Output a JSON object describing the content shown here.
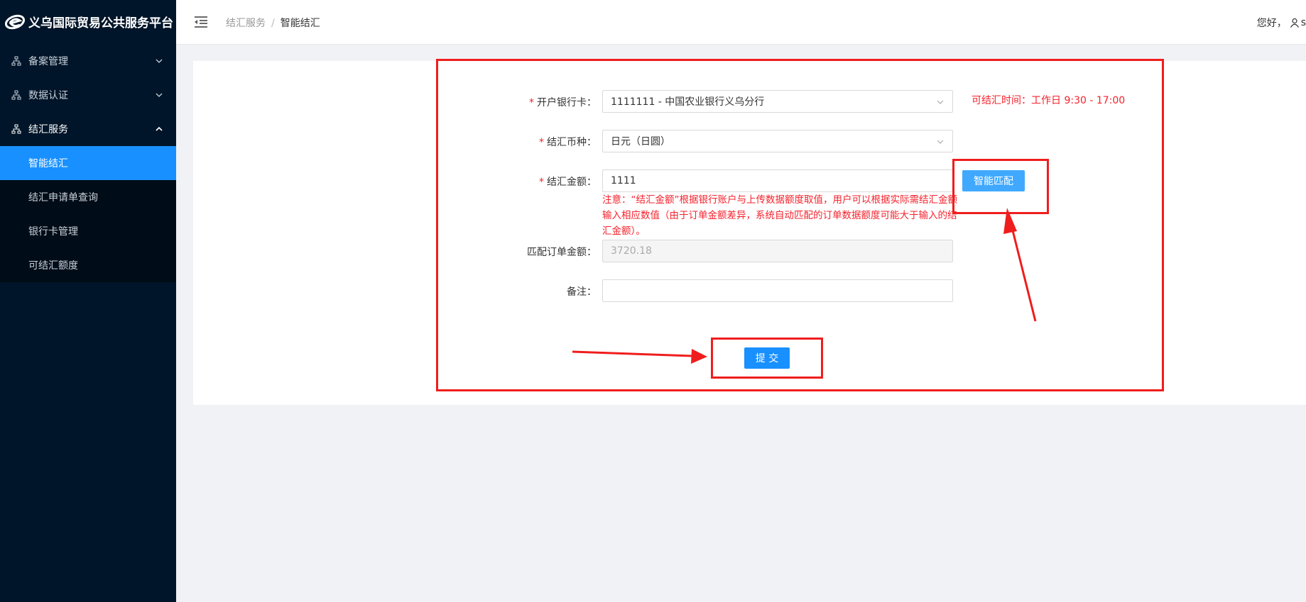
{
  "app": {
    "title": "义乌国际贸易公共服务平台"
  },
  "sidebar": {
    "menus": [
      {
        "label": "备案管理",
        "icon": "sitemap-icon",
        "open": false
      },
      {
        "label": "数据认证",
        "icon": "sitemap-icon",
        "open": false
      },
      {
        "label": "结汇服务",
        "icon": "sitemap-icon",
        "open": true
      }
    ],
    "submenu": [
      {
        "label": "智能结汇",
        "active": true
      },
      {
        "label": "结汇申请单查询",
        "active": false
      },
      {
        "label": "银行卡管理",
        "active": false
      },
      {
        "label": "可结汇额度",
        "active": false
      }
    ]
  },
  "header": {
    "breadcrumb": [
      "结汇服务",
      "智能结汇"
    ],
    "breadcrumb_sep": "/",
    "greeting": "您好，",
    "username": "s"
  },
  "form": {
    "bank_card": {
      "label": "开户银行卡：",
      "value": "1111111 - 中国农业银行义乌分行",
      "required": true
    },
    "currency": {
      "label": "结汇币种：",
      "value": "日元（日圆）",
      "required": true
    },
    "amount": {
      "label": "结汇金额：",
      "value": "1111",
      "required": true
    },
    "amount_hint": "注意：“结汇金额”根据银行账户与上传数据额度取值，用户可以根据实际需结汇金额输入相应数值（由于订单金额差异，系统自动匹配的订单数据额度可能大于输入的结汇金额）。",
    "matched_amount": {
      "label": "匹配订单金额：",
      "value": "3720.18"
    },
    "remark": {
      "label": "备注：",
      "value": ""
    },
    "time_note": "可结汇时间：工作日 9:30 - 17:00",
    "match_button": "智能匹配",
    "submit_button": "提 交",
    "required_mark": "*"
  },
  "colors": {
    "sidebar_bg": "#001529",
    "primary": "#1890ff",
    "annotation_red": "#f01d1d",
    "error_red": "#f5222d"
  }
}
